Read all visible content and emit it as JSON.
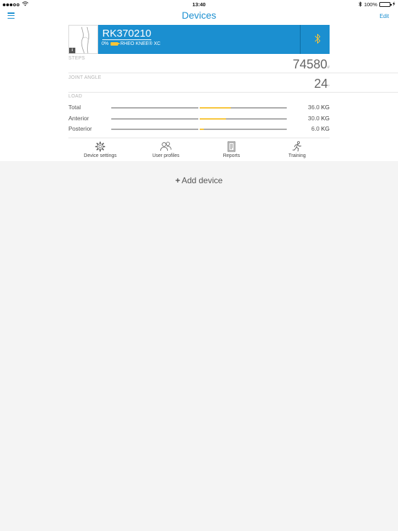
{
  "status_bar": {
    "time": "13:40",
    "battery_percent": "100%"
  },
  "nav": {
    "title": "Devices",
    "edit_label": "Edit"
  },
  "device": {
    "id": "RK370210",
    "battery_text": "0%",
    "model": "RHEO KNEE® XC",
    "info_badge": "i",
    "connected_icon": "bluetooth-icon"
  },
  "metrics": {
    "steps_label": "STEPS",
    "steps_value": "74580",
    "steps_unit": "#",
    "joint_angle_label": "JOINT ANGLE",
    "joint_angle_value": "24",
    "joint_angle_unit": "°"
  },
  "load": {
    "label": "LOAD",
    "unit": "KG",
    "rows": [
      {
        "name": "Total",
        "value": "36.0",
        "fill_fraction": 0.36
      },
      {
        "name": "Anterior",
        "value": "30.0",
        "fill_fraction": 0.3
      },
      {
        "name": "Posterior",
        "value": "6.0",
        "fill_fraction": 0.05
      }
    ]
  },
  "tabs": [
    {
      "label": "Device settings",
      "icon": "gear-icon"
    },
    {
      "label": "User profiles",
      "icon": "users-icon"
    },
    {
      "label": "Reports",
      "icon": "report-icon"
    },
    {
      "label": "Training",
      "icon": "runner-icon"
    }
  ],
  "add_device": {
    "label": "Add device"
  },
  "colors": {
    "accent": "#1b8fd0",
    "load_fill": "#f7c437",
    "battery_green": "#4cd964"
  }
}
